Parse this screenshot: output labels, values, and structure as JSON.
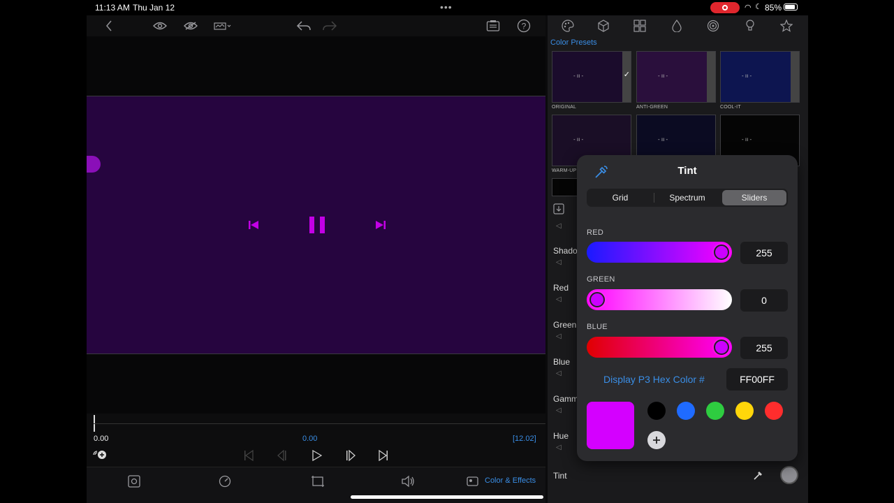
{
  "status": {
    "time": "11:13 AM",
    "date": "Thu Jan 12",
    "battery": "85%"
  },
  "player": {
    "time_start": "0.00",
    "time_current": "0.00",
    "time_total": "[12.02]"
  },
  "bottom": {
    "color_effects": "Color & Effects"
  },
  "presets": {
    "title": "Color Presets",
    "items": [
      {
        "label": "ORIGINAL"
      },
      {
        "label": "ANTI-GREEN"
      },
      {
        "label": "COOL-IT"
      },
      {
        "label": "WARM-UP"
      }
    ]
  },
  "adjust_rows": [
    "Shado",
    "Red",
    "Green",
    "Blue",
    "Gamm",
    "Hue"
  ],
  "tint_row_label": "Tint",
  "tint": {
    "title": "Tint",
    "tabs": [
      "Grid",
      "Spectrum",
      "Sliders"
    ],
    "active_tab": "Sliders",
    "channels": [
      {
        "label": "RED",
        "value": "255",
        "level": 1.0
      },
      {
        "label": "GREEN",
        "value": "0",
        "level": 0.0
      },
      {
        "label": "BLUE",
        "value": "255",
        "level": 1.0
      }
    ],
    "hex_label": "Display P3 Hex Color #",
    "hex_value": "FF00FF",
    "current_color": "#d400ff",
    "swatches": [
      "#000000",
      "#1f6bff",
      "#2ecc40",
      "#ffd60a",
      "#ff2d2d"
    ]
  },
  "colors": {
    "accent": "#3a8ee6",
    "video_bg": "#26053f",
    "magenta": "#d400ff"
  }
}
